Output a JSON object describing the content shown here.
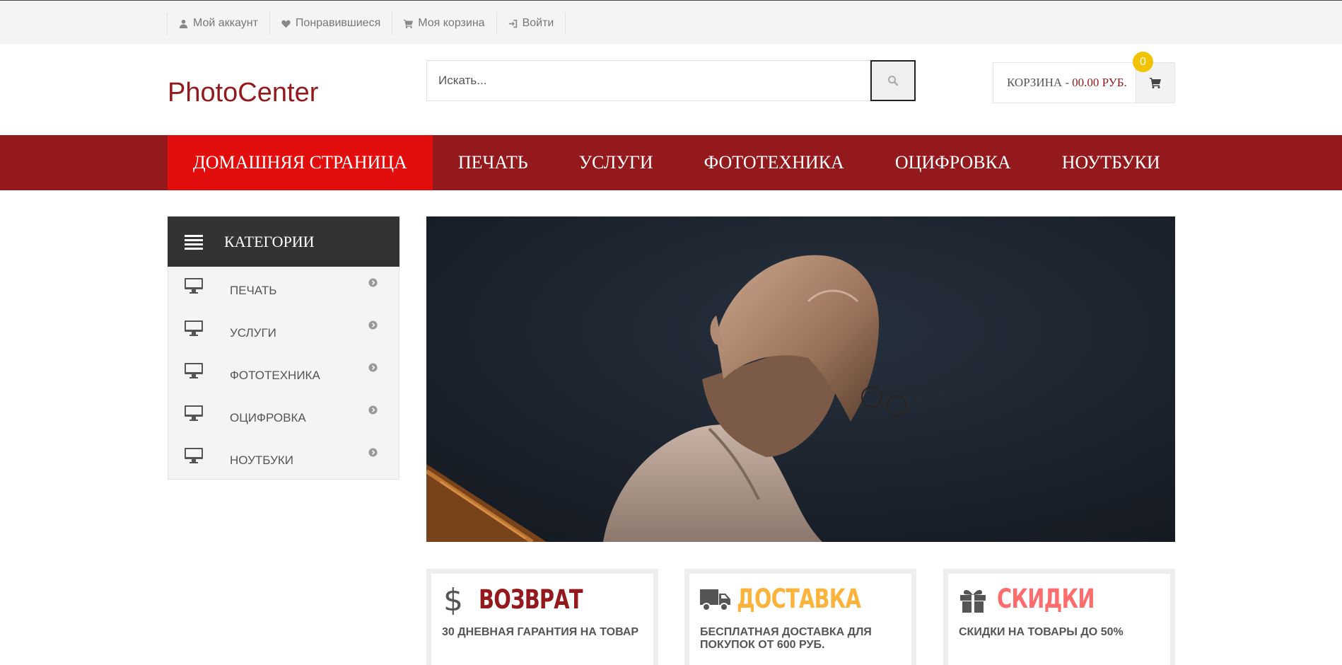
{
  "topbar": {
    "links": [
      {
        "label": "Мой аккаунт",
        "icon": "user-icon"
      },
      {
        "label": "Понравившиеся",
        "icon": "heart-icon"
      },
      {
        "label": "Моя корзина",
        "icon": "cart-icon"
      },
      {
        "label": "Войти",
        "icon": "sign-in-icon"
      }
    ]
  },
  "header": {
    "logo": "PhotoCenter",
    "search": {
      "placeholder": "Искать..."
    },
    "cart": {
      "label": "КОРЗИНА -",
      "total": "00.00 РУБ.",
      "count": "0"
    }
  },
  "nav": {
    "items": [
      "ДОМАШНЯЯ СТРАНИЦА",
      "ПЕЧАТЬ",
      "УСЛУГИ",
      "ФОТОТЕХНИКА",
      "ОЦИФРОВКА",
      "НОУТБУКИ"
    ],
    "active_index": 0
  },
  "sidebar": {
    "title": "КАТЕГОРИИ",
    "items": [
      {
        "label": "ПЕЧАТЬ"
      },
      {
        "label": "УСЛУГИ"
      },
      {
        "label": "ФОТОТЕХНИКА"
      },
      {
        "label": "ОЦИФРОВКА"
      },
      {
        "label": "НОУТБУКИ"
      }
    ]
  },
  "features": [
    {
      "title": "ВОЗВРАТ",
      "desc": "30 ДНЕВНАЯ ГАРАНТИЯ НА ТОВАР",
      "icon": "dollar-icon",
      "color": "#93191d"
    },
    {
      "title": "ДОСТАВКА",
      "desc": "БЕСПЛАТНАЯ ДОСТАВКА ДЛЯ ПОКУПОК ОТ 600 РУБ.",
      "icon": "truck-icon",
      "color": "#fbb33c"
    },
    {
      "title": "СКИДКИ",
      "desc": "СКИДКИ НА ТОВАРЫ ДО 50%",
      "icon": "gift-icon",
      "color": "#fe6d6d"
    }
  ],
  "colors": {
    "brand": "#93191d",
    "nav_active": "#e20e0e",
    "badge": "#f2c300"
  }
}
